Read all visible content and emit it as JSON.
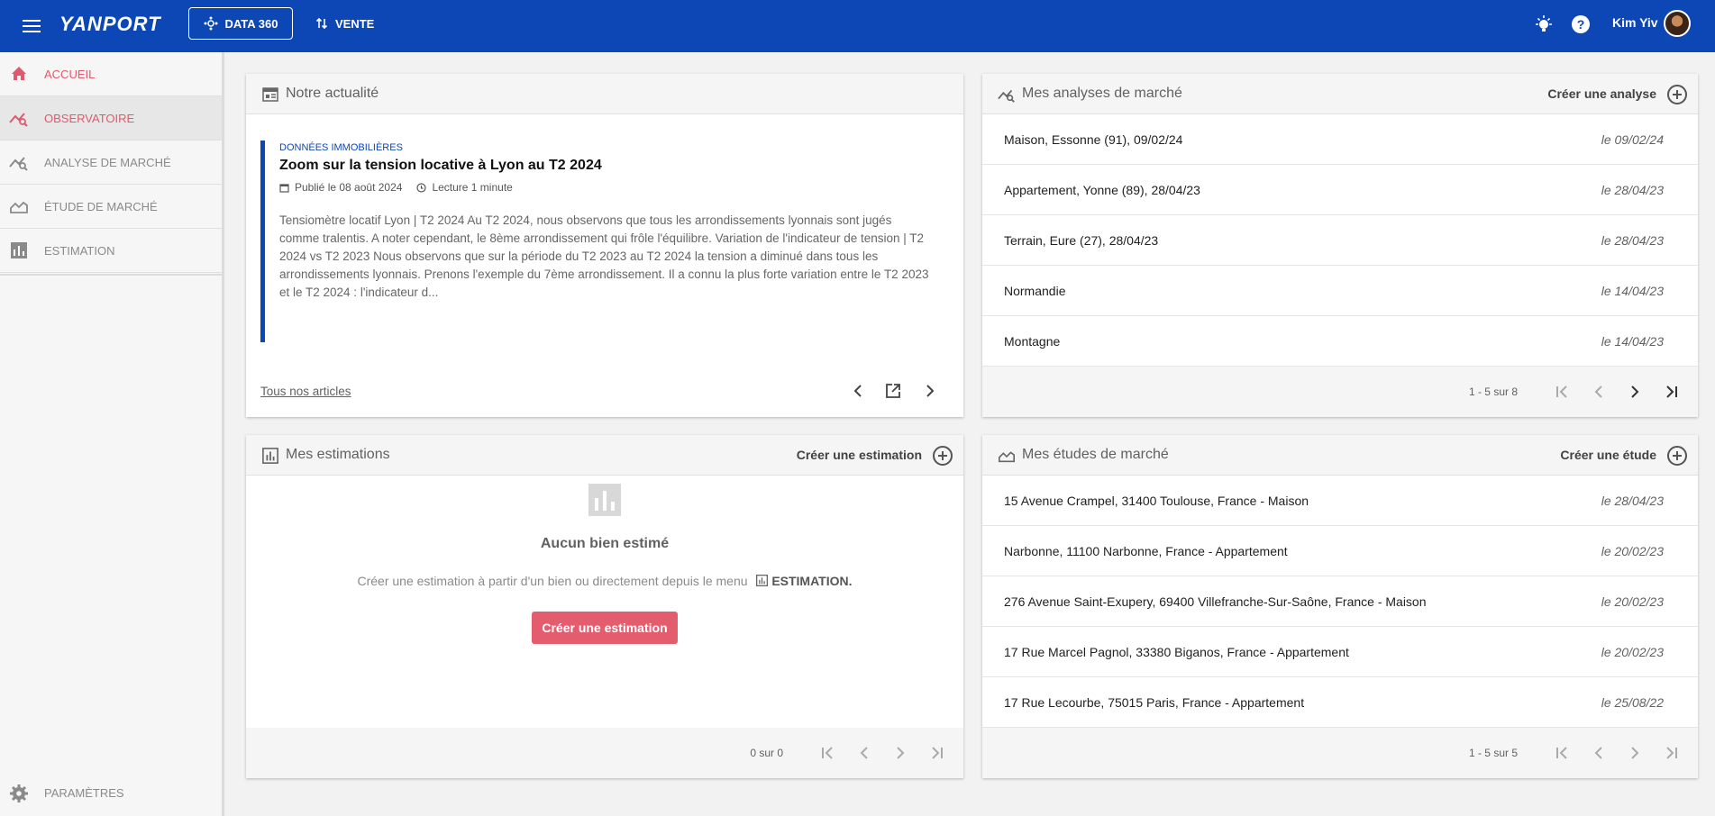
{
  "topbar": {
    "logo": "YANPORT",
    "data360_label": "DATA 360",
    "vente_label": "VENTE",
    "user_name": "Kim Yiv"
  },
  "sidebar": {
    "items": [
      {
        "label": "ACCUEIL",
        "icon": "home-icon"
      },
      {
        "label": "OBSERVATOIRE",
        "icon": "trend-search-icon"
      },
      {
        "label": "ANALYSE DE MARCHÉ",
        "icon": "trend-search-icon"
      },
      {
        "label": "ÉTUDE DE MARCHÉ",
        "icon": "area-chart-icon"
      },
      {
        "label": "ESTIMATION",
        "icon": "bar-chart-icon"
      }
    ],
    "settings_label": "PARAMÈTRES"
  },
  "news": {
    "title": "Notre actualité",
    "category": "DONNÉES IMMOBILIÈRES",
    "article_title": "Zoom sur la tension locative à Lyon au T2 2024",
    "published": "Publié le 08 août 2024",
    "reading": "Lecture 1 minute",
    "excerpt": "Tensiomètre locatif Lyon | T2 2024 Au T2 2024, nous observons que tous les arrondissements lyonnais sont jugés comme tralentis. A noter cependant, le 8ème arrondissement qui frôle l'équilibre. Variation de l'indicateur de tension | T2 2024 vs T2 2023 Nous observons que sur la période du T2 2023 au T2 2024 la tension a diminué dans tous les arrondissements lyonnais. Prenons l'exemple du 7ème arrondissement. Il a connu la plus forte variation entre le T2 2023 et le T2 2024 : l'indicateur d...",
    "all_articles": "Tous nos articles"
  },
  "analyses": {
    "title": "Mes analyses de marché",
    "action": "Créer une analyse",
    "rows": [
      {
        "name": "Maison, Essonne (91), 09/02/24",
        "date": "le 09/02/24"
      },
      {
        "name": "Appartement, Yonne (89), 28/04/23",
        "date": "le 28/04/23"
      },
      {
        "name": "Terrain, Eure (27), 28/04/23",
        "date": "le 28/04/23"
      },
      {
        "name": "Normandie",
        "date": "le 14/04/23"
      },
      {
        "name": "Montagne",
        "date": "le 14/04/23"
      }
    ],
    "pager": "1 - 5 sur 8"
  },
  "estimations": {
    "title": "Mes estimations",
    "action": "Créer une estimation",
    "empty_title": "Aucun bien estimé",
    "empty_text": "Créer une estimation à partir d'un bien ou directement depuis le menu",
    "empty_menu": "ESTIMATION.",
    "button": "Créer une estimation",
    "pager": "0 sur 0"
  },
  "etudes": {
    "title": "Mes études de marché",
    "action": "Créer une étude",
    "rows": [
      {
        "name": "15 Avenue Crampel, 31400 Toulouse, France - Maison",
        "date": "le 28/04/23"
      },
      {
        "name": "Narbonne, 11100 Narbonne, France - Appartement",
        "date": "le 20/02/23"
      },
      {
        "name": "276 Avenue Saint-Exupery, 69400 Villefranche-Sur-Saône, France - Maison",
        "date": "le 20/02/23"
      },
      {
        "name": "17 Rue Marcel Pagnol, 33380 Biganos, France - Appartement",
        "date": "le 20/02/23"
      },
      {
        "name": "17 Rue Lecourbe, 75015 Paris, France - Appartement",
        "date": "le 25/08/22"
      }
    ],
    "pager": "1 - 5 sur 5"
  },
  "colors": {
    "primary": "#0d47b5",
    "accent": "#e35d6f"
  }
}
